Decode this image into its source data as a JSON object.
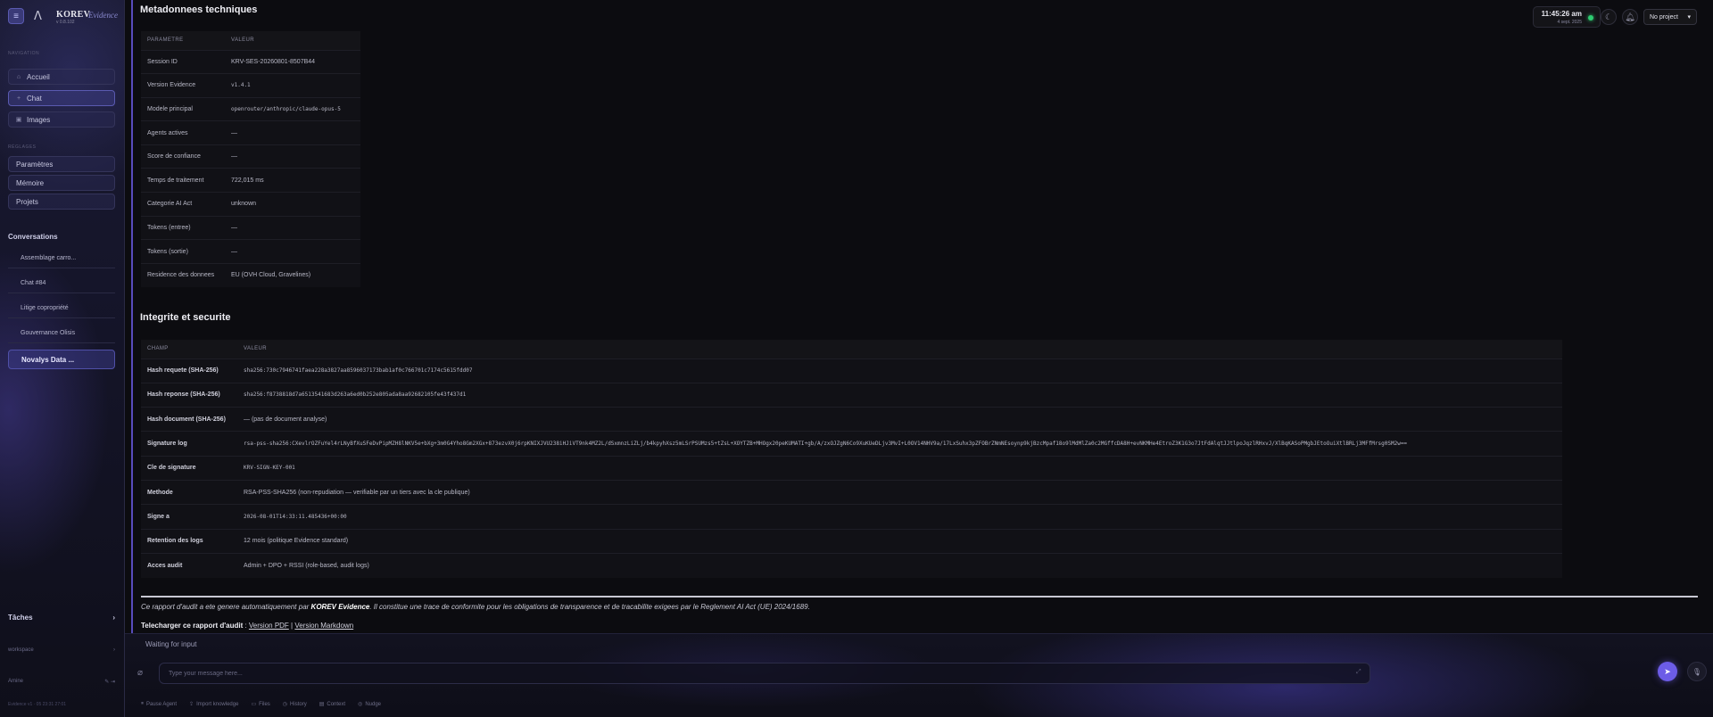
{
  "sidebar": {
    "brand": "KOREV",
    "brand_sub": "Evidence",
    "brand_version": "v 0.8.102",
    "section_nav": "NAVIGATION",
    "nav": [
      {
        "label": "Accueil",
        "icon": "home-icon"
      },
      {
        "label": "Chat",
        "icon": "plus-icon"
      },
      {
        "label": "Images",
        "icon": "image-icon"
      }
    ],
    "section_settings": "RÉGLAGES",
    "settings": [
      "Paramètres",
      "Mémoire",
      "Projets"
    ],
    "conversations_title": "Conversations",
    "conversations": [
      "Assemblage carro...",
      "Chat #84",
      "Litige copropriété",
      "Gouvernance Olisis",
      "Novalys Data ..."
    ],
    "tasks_label": "Tâches",
    "footer_workspace": "workspace",
    "footer_user": "Amine",
    "footer_tiny": "Evidence v1 · 05 23:31 27:01"
  },
  "header": {
    "time": "11:45:26 am",
    "date": "4 sept. 2025",
    "project": "No project"
  },
  "section1": {
    "title": "Metadonnees techniques",
    "col_param": "PARAMETRE",
    "col_value": "VALEUR",
    "rows": [
      {
        "k": "Session ID",
        "v": "KRV-SES-20260801-8507B44",
        "mono": false
      },
      {
        "k": "Version Evidence",
        "v": "v1.4.1",
        "mono": true
      },
      {
        "k": "Modele principal",
        "v": "openrouter/anthropic/claude-opus-5",
        "mono": true
      },
      {
        "k": "Agents actives",
        "v": "—",
        "mono": false
      },
      {
        "k": "Score de confiance",
        "v": "—",
        "mono": false
      },
      {
        "k": "Temps de traitement",
        "v": "722,015 ms",
        "mono": false
      },
      {
        "k": "Categorie AI Act",
        "v": "unknown",
        "mono": false
      },
      {
        "k": "Tokens (entree)",
        "v": "—",
        "mono": false
      },
      {
        "k": "Tokens (sortie)",
        "v": "—",
        "mono": false
      },
      {
        "k": "Residence des donnees",
        "v": "EU (OVH Cloud, Gravelines)",
        "mono": false
      }
    ]
  },
  "section2": {
    "title": "Integrite et securite",
    "col_field": "CHAMP",
    "col_value": "VALEUR",
    "rows": [
      {
        "k": "Hash requete (SHA-256)",
        "v": "sha256:730c7946741faea228a3827aa8596037173bab1af0c766701c7174c5615fdd07",
        "mono": true
      },
      {
        "k": "Hash reponse (SHA-256)",
        "v": "sha256:f8738818d7a6513541683d263a6ed0b252e805ada8aa92682105fe43f437d1",
        "mono": true
      },
      {
        "k": "Hash document (SHA-256)",
        "v": "— (pas de document analyse)",
        "mono": false
      },
      {
        "k": "Signature log",
        "v": "rsa-pss-sha256:CXevlrOZFuYel4rLNyBfXuSFeDvPipMZH8lNKV5e+bXg+3m0G4Yho8Gm2XGx+873ezvX0j6rpKNIXJVU238iHJiVT9nk4MZ2L/dSxmnzLiZLj/b4kpyhXsz5mLSrPSUMzs5+tZsL+XOYTZB+MHOgx20peKUMATI+gb/A/zxOJZgN6Co9XuKUeDLjv3MvI+L0OV14NHV9a/17LxSuhx3pZFOBrZNmNEsoynp9kjBzcMpaf18o9lMdMlZa0c2MGffcDA8H+evNKMHe4EtroZ3K1G3o7JtFdAlqtJJtlpoJqzlRHxvJ/XlBqKASoPMgbJEtoOuiXtlBRLj3MFfMrsg0SM2w==",
        "mono": true
      },
      {
        "k": "Cle de signature",
        "v": "KRV-SIGN-KEY-001",
        "mono": true
      },
      {
        "k": "Methode",
        "v": "RSA-PSS-SHA256 (non-repudiation — verifiable par un tiers avec la cle publique)",
        "mono": false
      },
      {
        "k": "Signe a",
        "v": "2026-08-01T14:33:11.485436+00:00",
        "mono": true
      },
      {
        "k": "Retention des logs",
        "v": "12 mois (politique Evidence standard)",
        "mono": false
      },
      {
        "k": "Acces audit",
        "v": "Admin + DPO + RSSI (role-based, audit logs)",
        "mono": false
      }
    ]
  },
  "footer_note": {
    "prefix": "Ce rapport d'audit a ete genere automatiquement par ",
    "brand": "KOREV Evidence",
    "suffix": ". Il constitue une trace de conformite pour les obligations de transparence et de tracabilite exigees par le Reglement AI Act (UE) 2024/1689."
  },
  "download": {
    "label": "Telecharger ce rapport d'audit",
    "sep1": " : ",
    "pdf": "Version PDF",
    "sep2": " | ",
    "md": "Version Markdown"
  },
  "composer": {
    "status": "Waiting for input",
    "placeholder": "Type your message here...",
    "tools": [
      "Pause Agent",
      "Import knowledge",
      "Files",
      "History",
      "Context",
      "Nudge"
    ]
  },
  "colors": {
    "accent": "#6c5ce7",
    "status_online": "#2ecc71"
  }
}
